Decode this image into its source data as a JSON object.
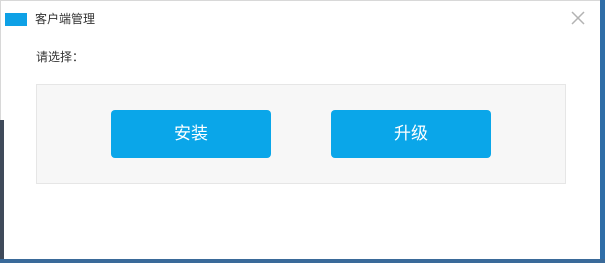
{
  "window": {
    "title": "客户端管理",
    "accent_color": "#0ea1e6",
    "close_icon": "close-icon"
  },
  "content": {
    "prompt": "请选择："
  },
  "actions": {
    "install_label": "安装",
    "upgrade_label": "升级",
    "button_color": "#0aa6e9"
  }
}
